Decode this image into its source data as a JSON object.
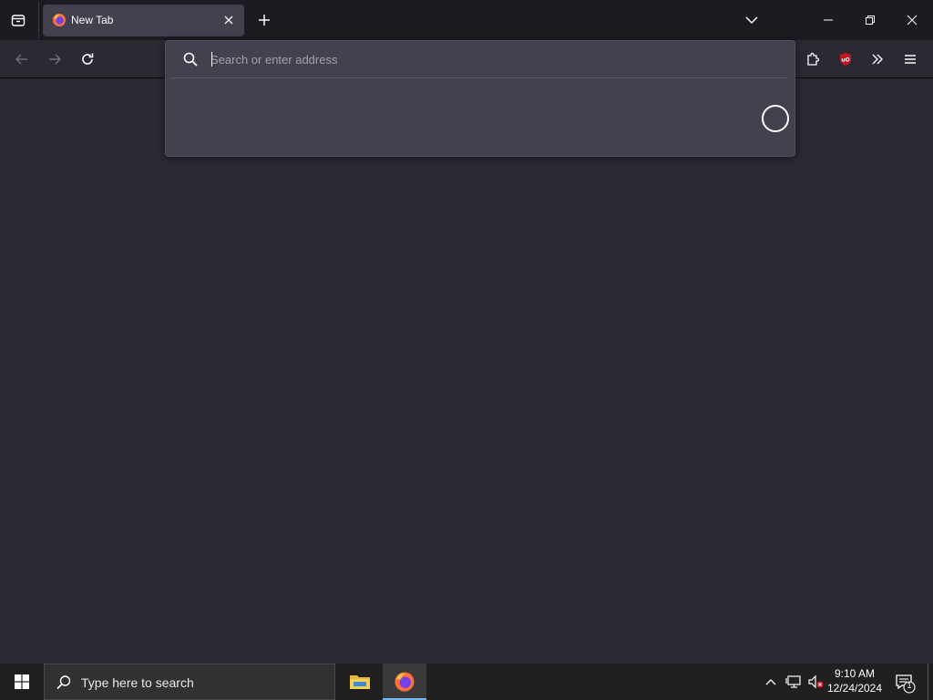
{
  "browser": {
    "tab": {
      "title": "New Tab",
      "favicon": "firefox-icon",
      "close_icon": "close-icon"
    },
    "new_tab_icon": "plus-icon",
    "list_all_tabs_icon": "chevron-down-icon",
    "window_controls": [
      "minimize-icon",
      "restore-icon",
      "close-icon"
    ],
    "nav": {
      "back_icon": "arrow-left-icon",
      "forward_icon": "arrow-right-icon",
      "reload_icon": "reload-icon",
      "extensions_icon": "puzzle-icon",
      "ublock_icon": "ublock-origin-icon",
      "overflow_icon": "double-chevron-right-icon",
      "menu_icon": "hamburger-menu-icon"
    },
    "urlbar": {
      "placeholder": "Search or enter address",
      "value": "",
      "search_icon": "search-icon",
      "loading_indicator": "spinner-icon"
    }
  },
  "taskbar": {
    "start_icon": "windows-logo-icon",
    "search_placeholder": "Type here to search",
    "apps": [
      {
        "name": "File Explorer",
        "icon": "folder-icon",
        "active": false
      },
      {
        "name": "Firefox",
        "icon": "firefox-icon",
        "active": true
      }
    ],
    "tray": {
      "icons": [
        "chevron-up-icon",
        "network-icon",
        "volume-muted-icon"
      ],
      "time": "9:10 AM",
      "date": "12/24/2024",
      "notification_count": "1"
    }
  },
  "colors": {
    "tabstrip_bg": "#1c1b22",
    "toolbar_bg": "#2b2a33",
    "urlbar_bg": "#42414d",
    "taskbar_bg": "#202020",
    "accent": "#76b9ed"
  }
}
